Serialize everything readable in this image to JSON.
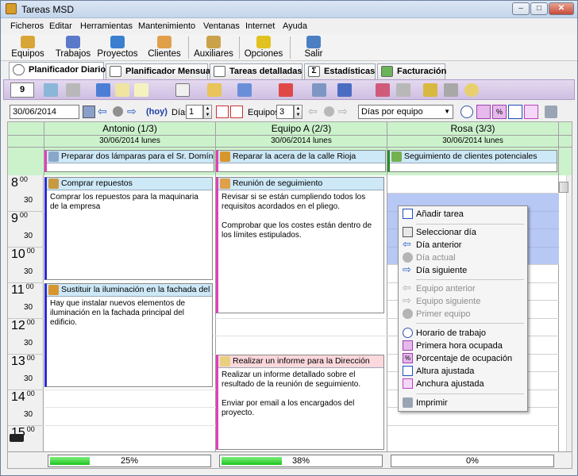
{
  "window": {
    "title": "Tareas MSD"
  },
  "menu": [
    "Ficheros",
    "Editar",
    "Herramientas",
    "Mantenimiento",
    "Ventanas",
    "Internet",
    "Ayuda"
  ],
  "toolbar": [
    "Equipos",
    "Trabajos",
    "Proyectos",
    "Clientes",
    "Auxiliares",
    "Opciones",
    "Salir"
  ],
  "tabs": [
    "Planificador Diario",
    "Planificador Mensual",
    "Tareas detalladas",
    "Estadísticas",
    "Facturación"
  ],
  "purplebar": {
    "number": "9"
  },
  "nav": {
    "date": "30/06/2014",
    "hoy": "(hoy)",
    "dias_label": "Días",
    "dias_value": "1",
    "equipos_label": "Equipos",
    "equipos_value": "3",
    "view_select": "Días por equipo"
  },
  "columns": [
    {
      "name": "Antonio  (1/3)",
      "date": "30/06/2014 lunes",
      "progress_label": "25%",
      "progress": 0.25
    },
    {
      "name": "Equipo A  (2/3)",
      "date": "30/06/2014 lunes",
      "progress_label": "38%",
      "progress": 0.38
    },
    {
      "name": "Rosa  (3/3)",
      "date": "30/06/2014 lunes",
      "progress_label": "0%",
      "progress": 0.0
    }
  ],
  "hours": [
    "8",
    "9",
    "10",
    "11",
    "12",
    "13",
    "14",
    "15"
  ],
  "hour_minutes": "00",
  "half_label": "30",
  "allday_tasks": [
    {
      "title": "Preparar dos lámparas para el Sr. Domínguez"
    },
    {
      "title": "Reparar la acera de la calle Rioja"
    },
    {
      "title": "Seguimiento de clientes potenciales"
    }
  ],
  "tasks": [
    {
      "title": "Comprar repuestos",
      "body": "Comprar los repuestos para la maquinaria de la empresa"
    },
    {
      "title": "Sustituir la iluminación en la fachada del edi...",
      "body": "Hay que instalar nuevos elementos de iluminación en la fachada principal del edificio."
    },
    {
      "title": "Reunión de seguimiento",
      "body1": "Revisar si se están cumpliendo todos los requisitos acordados en el pliego.",
      "body2": "Comprobar que los costes están dentro de los límites estipulados."
    },
    {
      "title": "Realizar un informe para la Dirección",
      "body1": "Realizar un informe detallado sobre el resultado de la reunión de seguimiento.",
      "body2": "Enviar por email a los encargados del proyecto."
    }
  ],
  "context_menu": [
    {
      "label": "Añadir tarea",
      "enabled": true
    },
    {
      "label": "Seleccionar día",
      "enabled": true
    },
    {
      "label": "Día anterior",
      "enabled": true
    },
    {
      "label": "Día actual",
      "enabled": false
    },
    {
      "label": "Día siguiente",
      "enabled": true
    },
    {
      "label": "Equipo anterior",
      "enabled": false
    },
    {
      "label": "Equipo siguiente",
      "enabled": false
    },
    {
      "label": "Primer equipo",
      "enabled": false
    },
    {
      "label": "Horario de trabajo",
      "enabled": true
    },
    {
      "label": "Primera hora ocupada",
      "enabled": true
    },
    {
      "label": "Porcentaje de ocupación",
      "enabled": true
    },
    {
      "label": "Altura ajustada",
      "enabled": true
    },
    {
      "label": "Anchura ajustada",
      "enabled": true
    },
    {
      "label": "Imprimir",
      "enabled": true
    }
  ],
  "colors": {
    "header_green": "#ccf2cc",
    "selection_blue": "#b8c8f4",
    "purple_bar": "#d8cbe9",
    "task_header": "#cde8f6",
    "task_header_pink": "#fbd8dc"
  }
}
